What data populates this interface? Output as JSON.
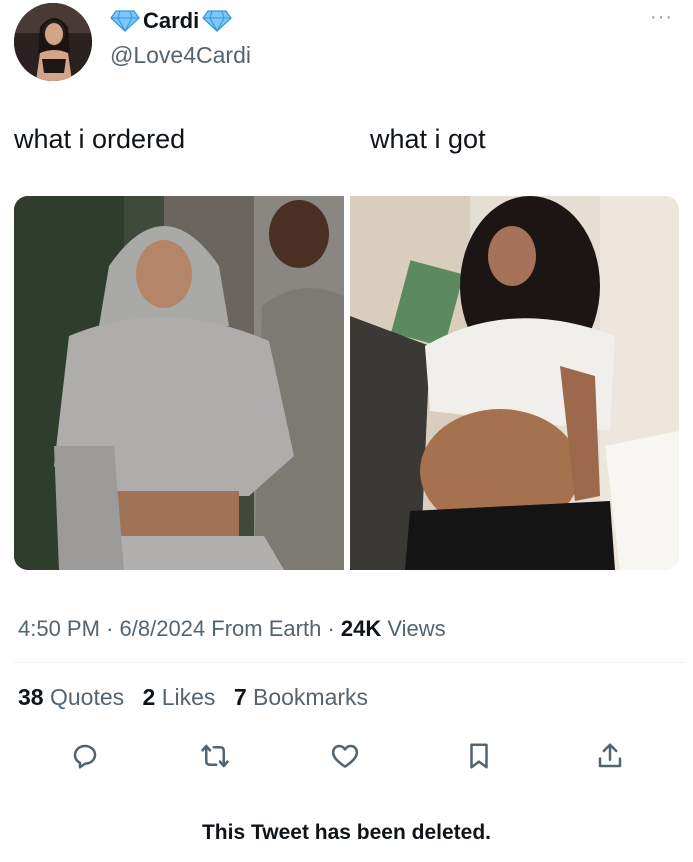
{
  "author": {
    "display_name": "Cardi",
    "handle": "@Love4Cardi",
    "badge_color": "#3fa9f5"
  },
  "tweet": {
    "caption_left": "what i ordered",
    "caption_right": "what i got",
    "time": "4:50 PM",
    "date": "6/8/2024",
    "source": "From Earth",
    "views_count": "24K",
    "views_label": "Views"
  },
  "stats": {
    "quotes_count": "38",
    "quotes_label": "Quotes",
    "likes_count": "2",
    "likes_label": "Likes",
    "bookmarks_count": "7",
    "bookmarks_label": "Bookmarks"
  },
  "actions": [
    "reply-icon",
    "retweet-icon",
    "like-icon",
    "bookmark-icon",
    "share-icon"
  ],
  "footer": {
    "deleted_notice": "This Tweet has been deleted."
  },
  "colors": {
    "text": "#0f1419",
    "secondary": "#536471",
    "divider": "#eff3f4",
    "icon": "#536471"
  }
}
